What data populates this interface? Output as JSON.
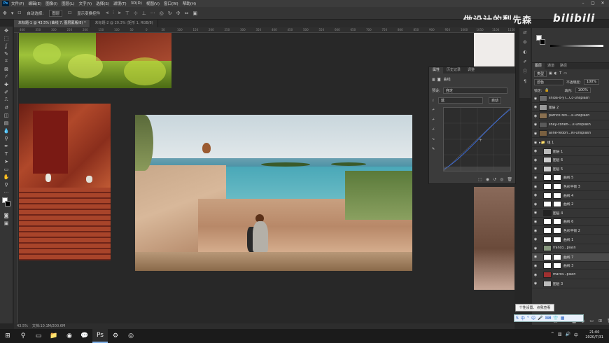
{
  "app": {
    "logo": "Ps"
  },
  "menu": [
    "文件(F)",
    "编辑(E)",
    "图像(I)",
    "图层(L)",
    "文字(Y)",
    "选择(S)",
    "滤镜(T)",
    "3D(D)",
    "视图(V)",
    "窗口(W)",
    "帮助(H)"
  ],
  "options_bar": {
    "auto_select": "自动选择:",
    "auto_select_value": "图层",
    "show_transform": "显示变换控件"
  },
  "doc_tabs": [
    {
      "label": "未标题-1 @ 43.5% (曲线 7, 图层蒙版/8) *"
    },
    {
      "label": "未标题-2 @ 20.3% (矩形 1, RGB/8)"
    }
  ],
  "ruler_ticks": [
    "400",
    "350",
    "300",
    "250",
    "200",
    "150",
    "100",
    "50",
    "0",
    "50",
    "100",
    "150",
    "200",
    "250",
    "300",
    "350",
    "400",
    "450",
    "500",
    "550",
    "600",
    "650",
    "700",
    "750",
    "800",
    "850",
    "900",
    "950",
    "1000",
    "1050",
    "1100",
    "1150"
  ],
  "watermark": {
    "text": "做设计的梨先森",
    "brand": "bilibili"
  },
  "properties": {
    "tabs": [
      "属性",
      "历史记录",
      "调整"
    ],
    "active_tab": 0,
    "title": "曲线",
    "preset_label": "预设:",
    "preset_value": "自定",
    "channel_value": "蓝",
    "auto_button": "自动"
  },
  "right_panel": {
    "tabs": [
      "图层",
      "通道",
      "路径"
    ],
    "kind_label": "类型",
    "blend_mode": "滤色",
    "opacity_label": "不透明度:",
    "opacity": "100%",
    "lock_label": "锁定:",
    "fill_label": "填充:",
    "fill": "100%"
  },
  "layers": [
    {
      "name": "shiba-d-yT...Cc-unsplash",
      "kind": "photo",
      "color": "#6b6b6b"
    },
    {
      "name": "图层 2",
      "kind": "pixel",
      "color": "#9a9a9a"
    },
    {
      "name": "patrick-fen-...k-unsplash",
      "kind": "photo",
      "color": "#8a7050"
    },
    {
      "name": "shay-cohen-...k-unsplash",
      "kind": "photo",
      "color": "#5a5a5a"
    },
    {
      "name": "aline-fedori...NI-unsplash",
      "kind": "photo",
      "color": "#7a6040"
    },
    {
      "name": "组 1",
      "kind": "group",
      "color": "#444"
    },
    {
      "name": "图层 1",
      "kind": "pixel",
      "color": "#bbbbbb"
    },
    {
      "name": "图层 6",
      "kind": "pixel",
      "color": "#cccccc"
    },
    {
      "name": "图层 5",
      "kind": "pixel",
      "color": "#cccccc"
    },
    {
      "name": "曲线 5",
      "kind": "adj",
      "color": "#ffffff"
    },
    {
      "name": "色彩平衡 3",
      "kind": "adj",
      "color": "#ffffff"
    },
    {
      "name": "曲线 4",
      "kind": "adj",
      "color": "#ffffff"
    },
    {
      "name": "曲线 2",
      "kind": "adj",
      "color": "#ffffff"
    },
    {
      "name": "图层 4",
      "kind": "pixel",
      "color": "#222222"
    },
    {
      "name": "曲线 6",
      "kind": "adj",
      "color": "#ffffff"
    },
    {
      "name": "色彩平衡 2",
      "kind": "adj",
      "color": "#ffffff"
    },
    {
      "name": "曲线 1",
      "kind": "adj",
      "color": "#ffffff"
    },
    {
      "name": "franco...plash",
      "kind": "photo",
      "color": "#8a9a80"
    },
    {
      "name": "曲线 7",
      "kind": "adj",
      "color": "#ffffff",
      "selected": true
    },
    {
      "name": "曲线 3",
      "kind": "adj",
      "color": "#ffffff"
    },
    {
      "name": "marco...plash",
      "kind": "photo",
      "color": "#a03030"
    },
    {
      "name": "图层 3",
      "kind": "pixel",
      "color": "#bbbbbb"
    }
  ],
  "tooltip": "个性设置、点我查看",
  "status": {
    "zoom": "43.5%",
    "doc": "文档:10.1M/200.6M"
  },
  "clock": {
    "time": "21:00",
    "date": "2020/7/31"
  }
}
